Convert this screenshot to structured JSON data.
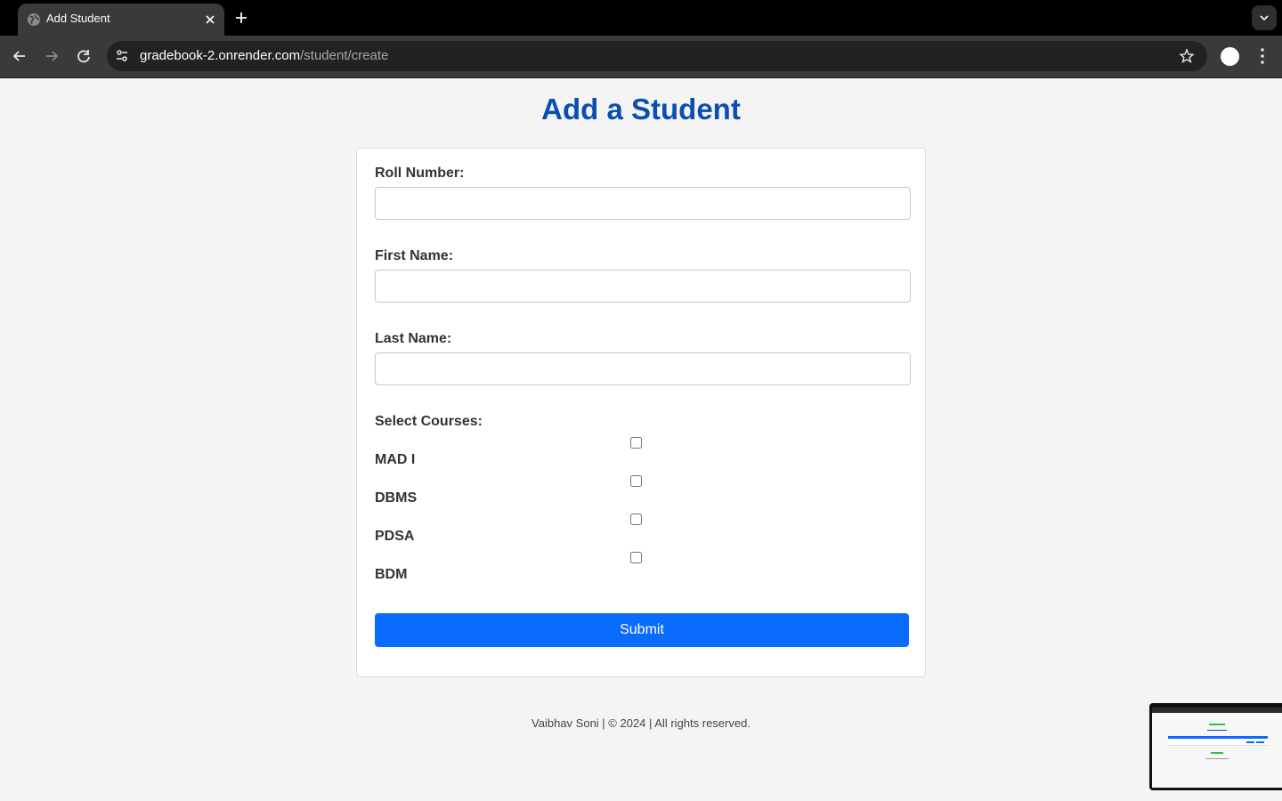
{
  "browser": {
    "tab_title": "Add Student",
    "url_domain": "gradebook-2.onrender.com",
    "url_path": "/student/create"
  },
  "page": {
    "title": "Add a Student",
    "form": {
      "roll_number_label": "Roll Number:",
      "roll_number_value": "",
      "first_name_label": "First Name:",
      "first_name_value": "",
      "last_name_label": "Last Name:",
      "last_name_value": "",
      "courses_label": "Select Courses:",
      "courses": [
        {
          "label": "MAD I",
          "checked": false
        },
        {
          "label": "DBMS",
          "checked": false
        },
        {
          "label": "PDSA",
          "checked": false
        },
        {
          "label": "BDM",
          "checked": false
        }
      ],
      "submit_label": "Submit"
    },
    "footer": "Vaibhav Soni | © 2024 | All rights reserved."
  },
  "colors": {
    "title": "#0a4fb0",
    "submit_button": "#0a6cff",
    "page_background": "#f4f4f4"
  }
}
